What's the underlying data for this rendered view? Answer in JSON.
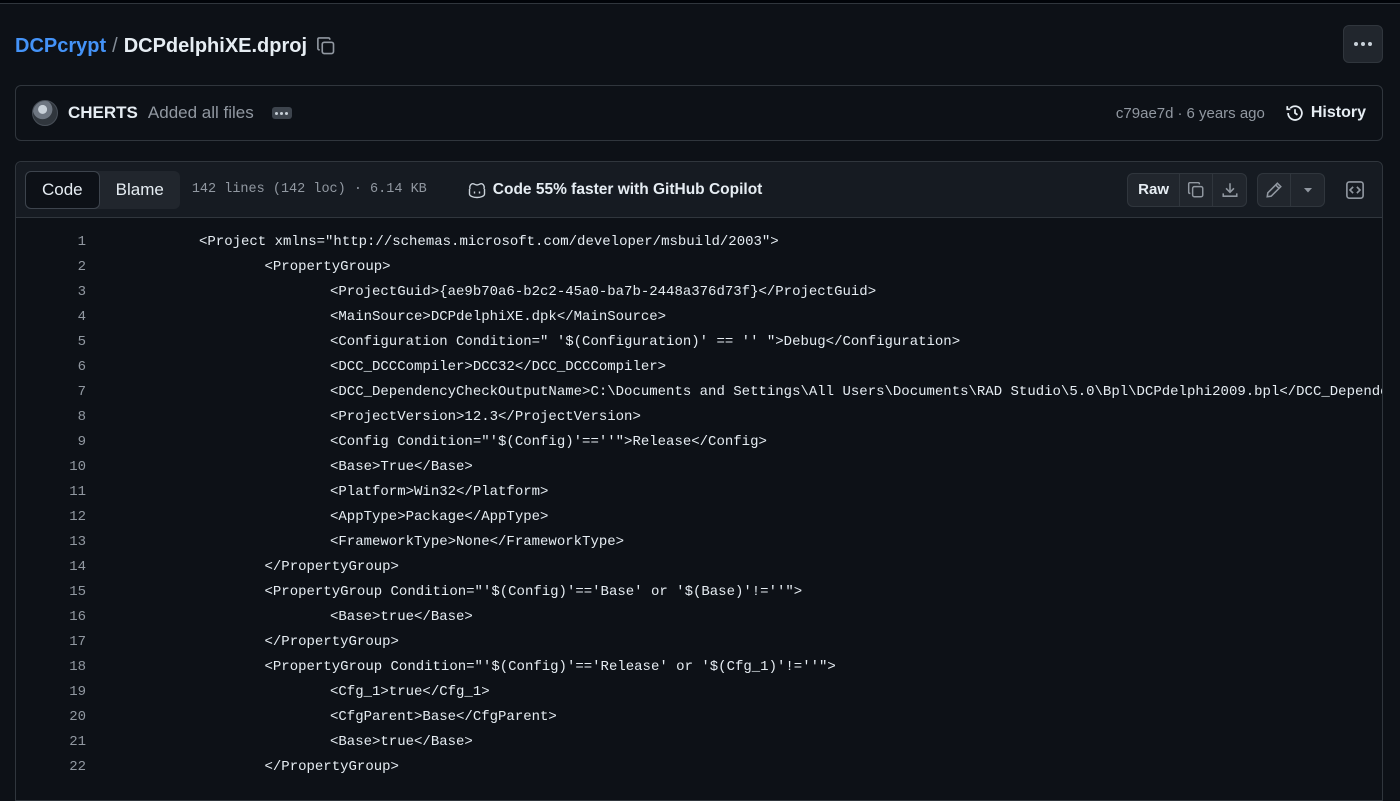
{
  "breadcrumb": {
    "repo": "DCPcrypt",
    "separator": "/",
    "file": "DCPdelphiXE.dproj"
  },
  "commit": {
    "author": "CHERTS",
    "message": "Added all files",
    "sha": "c79ae7d",
    "separator": "·",
    "time": "6 years ago",
    "history_label": "History"
  },
  "file_header": {
    "tabs": [
      "Code",
      "Blame"
    ],
    "active_tab": "Code",
    "info": "142 lines (142 loc) · 6.14 KB",
    "copilot": "Code 55% faster with GitHub Copilot",
    "raw_label": "Raw"
  },
  "code_lines": [
    {
      "n": "1",
      "text": "<Project xmlns=\"http://schemas.microsoft.com/developer/msbuild/2003\">",
      "indent": 0
    },
    {
      "n": "2",
      "text": "<PropertyGroup>",
      "indent": 1
    },
    {
      "n": "3",
      "text": "<ProjectGuid>{ae9b70a6-b2c2-45a0-ba7b-2448a376d73f}</ProjectGuid>",
      "indent": 2
    },
    {
      "n": "4",
      "text": "<MainSource>DCPdelphiXE.dpk</MainSource>",
      "indent": 2
    },
    {
      "n": "5",
      "text": "<Configuration Condition=\" '$(Configuration)' == '' \">Debug</Configuration>",
      "indent": 2
    },
    {
      "n": "6",
      "text": "<DCC_DCCCompiler>DCC32</DCC_DCCCompiler>",
      "indent": 2
    },
    {
      "n": "7",
      "text": "<DCC_DependencyCheckOutputName>C:\\Documents and Settings\\All Users\\Documents\\RAD Studio\\5.0\\Bpl\\DCPdelphi2009.bpl</DCC_Dependenc",
      "indent": 2
    },
    {
      "n": "8",
      "text": "<ProjectVersion>12.3</ProjectVersion>",
      "indent": 2
    },
    {
      "n": "9",
      "text": "<Config Condition=\"'$(Config)'==''\">Release</Config>",
      "indent": 2
    },
    {
      "n": "10",
      "text": "<Base>True</Base>",
      "indent": 2
    },
    {
      "n": "11",
      "text": "<Platform>Win32</Platform>",
      "indent": 2
    },
    {
      "n": "12",
      "text": "<AppType>Package</AppType>",
      "indent": 2
    },
    {
      "n": "13",
      "text": "<FrameworkType>None</FrameworkType>",
      "indent": 2
    },
    {
      "n": "14",
      "text": "</PropertyGroup>",
      "indent": 1
    },
    {
      "n": "15",
      "text": "<PropertyGroup Condition=\"'$(Config)'=='Base' or '$(Base)'!=''\">",
      "indent": 1
    },
    {
      "n": "16",
      "text": "<Base>true</Base>",
      "indent": 2
    },
    {
      "n": "17",
      "text": "</PropertyGroup>",
      "indent": 1
    },
    {
      "n": "18",
      "text": "<PropertyGroup Condition=\"'$(Config)'=='Release' or '$(Cfg_1)'!=''\">",
      "indent": 1
    },
    {
      "n": "19",
      "text": "<Cfg_1>true</Cfg_1>",
      "indent": 2
    },
    {
      "n": "20",
      "text": "<CfgParent>Base</CfgParent>",
      "indent": 2
    },
    {
      "n": "21",
      "text": "<Base>true</Base>",
      "indent": 2
    },
    {
      "n": "22",
      "text": "</PropertyGroup>",
      "indent": 1
    }
  ],
  "colors": {
    "link": "#4493f8",
    "background": "#0d1117",
    "border": "#30363d"
  },
  "icons": [
    "copy-icon",
    "kebab-icon",
    "history-icon",
    "copilot-icon",
    "download-icon",
    "pencil-icon",
    "triangle-down-icon",
    "code-square-icon"
  ]
}
